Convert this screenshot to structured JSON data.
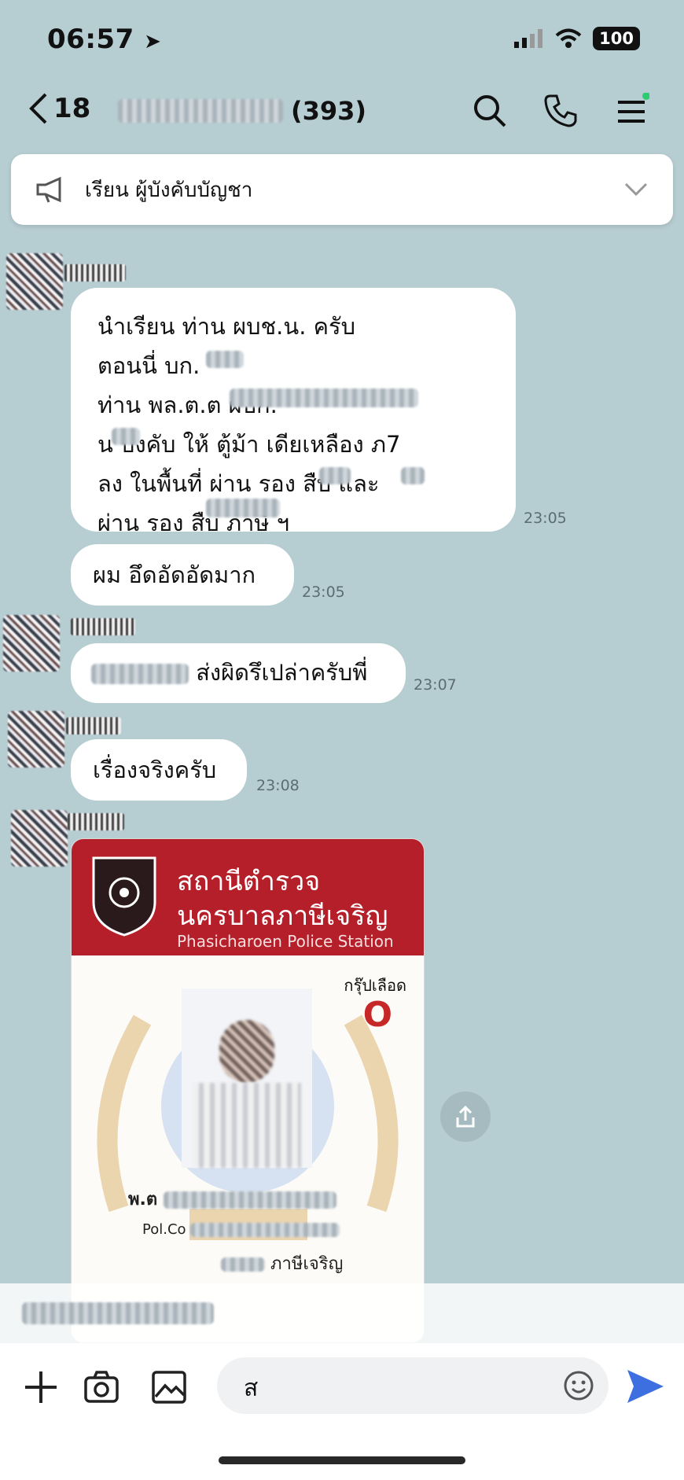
{
  "status": {
    "time": "06:57",
    "battery": "100"
  },
  "header": {
    "back_count": "18",
    "member_count": "(393)"
  },
  "announcement": {
    "text": "เรียน ผู้บังคับบัญชา"
  },
  "messages": [
    {
      "lines": [
        "นำเรียน   ท่าน   ผบช.น. ครับ",
        "ตอนนี่  บก.",
        "ท่าน  พล.ต.ต                     ผบก.",
        "น     บังคับ  ให้ ตู้ม้า  เดียเหลือง  ภ7",
        "ลง  ในพื้นที่  ผ่าน  รอง     สืบ      และ",
        "ผ่าน  รอง               สืบ ภาษี ฯ"
      ],
      "time": "23:05"
    },
    {
      "text": "ผม อึดอัดอัดมาก",
      "time": "23:05"
    },
    {
      "text": "ส่งผิดรึเปล่าครับพี่",
      "time": "23:07"
    },
    {
      "text": "เรื่องจริงครับ",
      "time": "23:08"
    }
  ],
  "id_card": {
    "title_th_1": "สถานีตำรวจ",
    "title_th_2": "นครบาลภาษีเจริญ",
    "title_en": "Phasicharoen Police Station",
    "blood_label": "กรุ๊ปเลือด",
    "blood_type": "O",
    "name_th_prefix": "พ.ต",
    "name_en_prefix": "Pol.Co",
    "station_suffix": "ภาษีเจริญ"
  },
  "composer": {
    "input_value": "ส"
  },
  "colors": {
    "chat_bg": "#b6cdd1",
    "card_red": "#b51f2a",
    "send_blue": "#3d6fe0"
  }
}
